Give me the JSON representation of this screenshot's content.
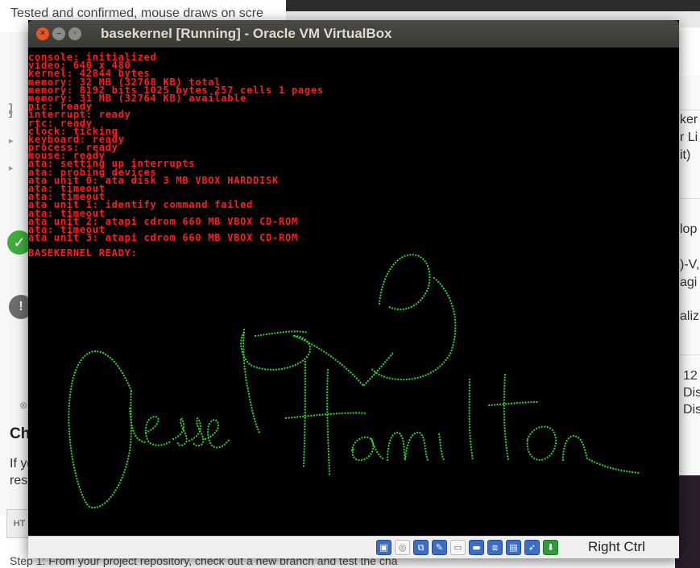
{
  "background": {
    "top_text": "Tested and confirmed, mouse draws on scre",
    "right_fragments": [
      "ker",
      "r Li",
      "it)",
      "lop",
      ")-V,",
      "agi",
      "aliz",
      "12",
      "Dis",
      "Dis"
    ],
    "heading": "Ch",
    "left_fragments": [
      "If yo",
      "rese"
    ],
    "bar_label": "HT",
    "step_text": "Step 1: From your project repository, check out a new branch and test the cha"
  },
  "window": {
    "title": "basekernel [Running] - Oracle VM VirtualBox",
    "buttons": {
      "close": "×",
      "minimize": "–",
      "maximize": "▫"
    }
  },
  "console": {
    "color": "#ff1c1c",
    "lines": [
      "console: initialized",
      "video: 640 x 480",
      "kernel: 42844 bytes",
      "memory: 32 MB (32768 KB) total",
      "memory: 8192 bits 1025 bytes 257 cells 1 pages",
      "memory: 31 MB (32764 KB) available",
      "pic: ready",
      "interrupt: ready",
      "rtc: ready",
      "clock: ticking",
      "keyboard: ready",
      "process: ready",
      "mouse: ready",
      "ata: setting up interrupts",
      "ata: probing devices",
      "ata unit 0: ata disk 3 MB VBOX HARDDISK",
      "ata: timeout",
      "ata: timeout",
      "ata unit 1: identify command failed",
      "ata: timeout",
      "ata unit 2: atapi cdrom 660 MB VBOX CD-ROM",
      "ata: timeout",
      "ata unit 3: atapi cdrom 660 MB VBOX CD-ROM"
    ],
    "ready_line": "BASEKERNEL READY:"
  },
  "drawing": {
    "color": "#2fd22f",
    "description_hidden": true
  },
  "statusbar": {
    "icons": [
      {
        "name": "hard-disk-icon",
        "glyph": "▣"
      },
      {
        "name": "optical-drive-icon",
        "glyph": "◎"
      },
      {
        "name": "network-icon",
        "glyph": "⧉"
      },
      {
        "name": "usb-icon",
        "glyph": "✎"
      },
      {
        "name": "shared-folders-icon",
        "glyph": "▭"
      },
      {
        "name": "display-icon",
        "glyph": "▬"
      },
      {
        "name": "video-capture-icon",
        "glyph": "⧈"
      },
      {
        "name": "cpu-icon",
        "glyph": "▤"
      },
      {
        "name": "mouse-integration-icon",
        "glyph": "➶"
      },
      {
        "name": "keyboard-capture-icon",
        "glyph": "⬇"
      }
    ],
    "host_key": "Right Ctrl"
  }
}
